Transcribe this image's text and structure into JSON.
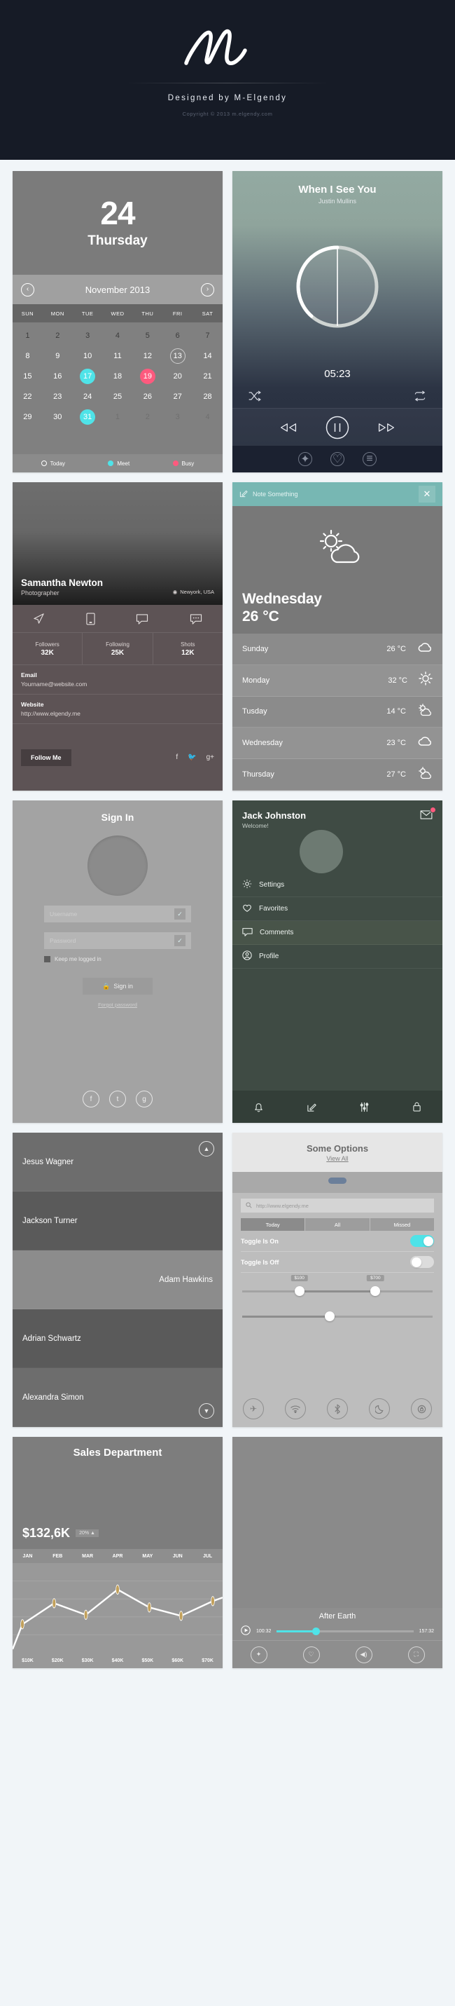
{
  "header": {
    "logo": "m-script-logo",
    "designed_by": "Designed by M-Elgendy",
    "copyright": "Copyright © 2013 m.elgendy.com"
  },
  "calendar": {
    "day_number": "24",
    "day_name": "Thursday",
    "month": "November 2013",
    "prev_icon": "chevron-left-icon",
    "next_icon": "chevron-right-icon",
    "dow": [
      "SUN",
      "MON",
      "TUE",
      "WED",
      "THU",
      "FRI",
      "SAT"
    ],
    "weeks": [
      [
        {
          "d": "1",
          "s": "dark"
        },
        {
          "d": "2",
          "s": "dark"
        },
        {
          "d": "3",
          "s": "dark"
        },
        {
          "d": "4",
          "s": "dark"
        },
        {
          "d": "5",
          "s": "dark"
        },
        {
          "d": "6",
          "s": "dark"
        },
        {
          "d": "7",
          "s": "dark"
        }
      ],
      [
        {
          "d": "8",
          "s": ""
        },
        {
          "d": "9",
          "s": ""
        },
        {
          "d": "10",
          "s": ""
        },
        {
          "d": "11",
          "s": ""
        },
        {
          "d": "12",
          "s": ""
        },
        {
          "d": "13",
          "s": "ring"
        },
        {
          "d": "14",
          "s": ""
        }
      ],
      [
        {
          "d": "15",
          "s": ""
        },
        {
          "d": "16",
          "s": ""
        },
        {
          "d": "17",
          "s": "cyan"
        },
        {
          "d": "18",
          "s": ""
        },
        {
          "d": "19",
          "s": "pink"
        },
        {
          "d": "20",
          "s": ""
        },
        {
          "d": "21",
          "s": ""
        }
      ],
      [
        {
          "d": "22",
          "s": ""
        },
        {
          "d": "23",
          "s": ""
        },
        {
          "d": "24",
          "s": ""
        },
        {
          "d": "25",
          "s": ""
        },
        {
          "d": "26",
          "s": ""
        },
        {
          "d": "27",
          "s": ""
        },
        {
          "d": "28",
          "s": ""
        }
      ],
      [
        {
          "d": "29",
          "s": ""
        },
        {
          "d": "30",
          "s": ""
        },
        {
          "d": "31",
          "s": "cyan"
        },
        {
          "d": "1",
          "s": "dim"
        },
        {
          "d": "2",
          "s": "dim"
        },
        {
          "d": "3",
          "s": "dim"
        },
        {
          "d": "4",
          "s": "dim"
        }
      ]
    ],
    "legend": [
      {
        "label": "Today",
        "color": "#ffffff",
        "kind": "white"
      },
      {
        "label": "Meet",
        "color": "#4fe3e8",
        "kind": "cyan"
      },
      {
        "label": "Busy",
        "color": "#fd5a7e",
        "kind": "pink"
      }
    ]
  },
  "music": {
    "title": "When I See You",
    "artist": "Justin Mullins",
    "time": "05:23",
    "shuffle_icon": "shuffle-icon",
    "repeat_icon": "repeat-icon",
    "prev_icon": "rewind-icon",
    "play_icon": "pause-icon",
    "next_icon": "fast-forward-icon",
    "bottom_icons": [
      "share-icon",
      "heart-icon",
      "playlist-icon"
    ]
  },
  "profile": {
    "name": "Samantha Newton",
    "role": "Photographer",
    "location": "Newyork, USA",
    "location_icon": "map-pin-icon",
    "action_icons": [
      "send-icon",
      "phone-icon",
      "chat-icon",
      "more-icon"
    ],
    "stats": [
      {
        "label": "Followers",
        "value": "32K"
      },
      {
        "label": "Following",
        "value": "25K"
      },
      {
        "label": "Shots",
        "value": "12K"
      }
    ],
    "fields": [
      {
        "key": "Email",
        "value": "Yourname@website.com"
      },
      {
        "key": "Website",
        "value": "http://www.elgendy.me"
      }
    ],
    "follow_label": "Follow Me",
    "social": [
      "facebook-icon",
      "twitter-icon",
      "google-plus-icon"
    ]
  },
  "weather": {
    "note_placeholder": "Note Something",
    "note_icon": "compose-icon",
    "close_icon": "close-icon",
    "hero_icon": "sun-cloud-icon",
    "hero_day": "Wednesday",
    "hero_temp": "26 °C",
    "forecast": [
      {
        "day": "Sunday",
        "temp": "26 °C",
        "icon": "cloud-icon"
      },
      {
        "day": "Monday",
        "temp": "32 °C",
        "icon": "sun-icon"
      },
      {
        "day": "Tusday",
        "temp": "14 °C",
        "icon": "sun-cloud-icon"
      },
      {
        "day": "Wednesday",
        "temp": "23 °C",
        "icon": "cloud-icon"
      },
      {
        "day": "Thursday",
        "temp": "27 °C",
        "icon": "sun-cloud-icon"
      }
    ]
  },
  "signin": {
    "title": "Sign In",
    "avatar": "avatar-placeholder",
    "username_placeholder": "Username",
    "password_placeholder": "Password",
    "field_icon": "check-icon",
    "remember_label": "Keep me logged in",
    "button_label": "Sign in",
    "button_icon": "lock-icon",
    "forgot_label": "Forgot password",
    "social": [
      "facebook-icon",
      "twitter-icon",
      "google-plus-icon"
    ]
  },
  "menu": {
    "name": "Jack Johnston",
    "welcome": "Welcome!",
    "mail_icon": "mail-icon",
    "badge": "1",
    "items": [
      {
        "label": "Settings",
        "icon": "gear-icon"
      },
      {
        "label": "Favorites",
        "icon": "heart-icon"
      },
      {
        "label": "Comments",
        "icon": "comment-icon"
      },
      {
        "label": "Profile",
        "icon": "user-icon"
      }
    ],
    "bar_icons": [
      "bell-icon",
      "compose-icon",
      "sliders-icon",
      "lock-icon"
    ]
  },
  "contacts": {
    "up_icon": "chevron-up-icon",
    "down_icon": "chevron-down-icon",
    "items": [
      {
        "name": "Jesus Wagner"
      },
      {
        "name": "Jackson Turner"
      },
      {
        "name": "Adam Hawkins"
      },
      {
        "name": "Adrian Schwartz"
      },
      {
        "name": "Alexandra Simon"
      }
    ]
  },
  "options": {
    "title": "Some Options",
    "view_all": "View All",
    "search_icon": "search-icon",
    "search_placeholder": "http://www.elgendy.me",
    "segments": [
      {
        "label": "Today",
        "active": true
      },
      {
        "label": "All",
        "active": false
      },
      {
        "label": "Missed",
        "active": false
      }
    ],
    "toggles": [
      {
        "label": "Toggle Is On",
        "state": "on"
      },
      {
        "label": "Toggle Is Off",
        "state": "off"
      }
    ],
    "range_slider": {
      "min_label": "$100",
      "max_label": "$700",
      "low_pct": 30,
      "high_pct": 70
    },
    "single_slider": {
      "pct": 46
    },
    "dock_icons": [
      "airplane-icon",
      "wifi-icon",
      "bluetooth-icon",
      "moon-icon",
      "rotate-lock-icon"
    ]
  },
  "sales": {
    "title": "Sales Department",
    "amount": "$132,6K",
    "delta": "20% ▲"
  },
  "chart_data": {
    "type": "line",
    "title": "Sales Department",
    "categories": [
      "JAN",
      "FEB",
      "MAR",
      "APR",
      "MAY",
      "JUN",
      "JUL"
    ],
    "x_bottom_labels": [
      "$10K",
      "$20K",
      "$30K",
      "$40K",
      "$50K",
      "$60K",
      "$70K"
    ],
    "values": [
      22,
      42,
      31,
      55,
      38,
      30,
      44
    ],
    "series": [
      {
        "name": "Sales",
        "values": [
          22,
          42,
          31,
          55,
          38,
          30,
          44
        ]
      }
    ],
    "xlabel": "",
    "ylabel": "",
    "ylim": [
      0,
      70
    ],
    "grid": true,
    "legend": "none",
    "line_color": "#ffffff",
    "point_color": "#c2a05a"
  },
  "movie": {
    "title": "After Earth",
    "time_current": "100:32",
    "time_total": "157:32",
    "play_icon": "play-icon",
    "bar_icons": [
      "share-icon",
      "heart-icon",
      "volume-icon",
      "fullscreen-icon"
    ]
  }
}
